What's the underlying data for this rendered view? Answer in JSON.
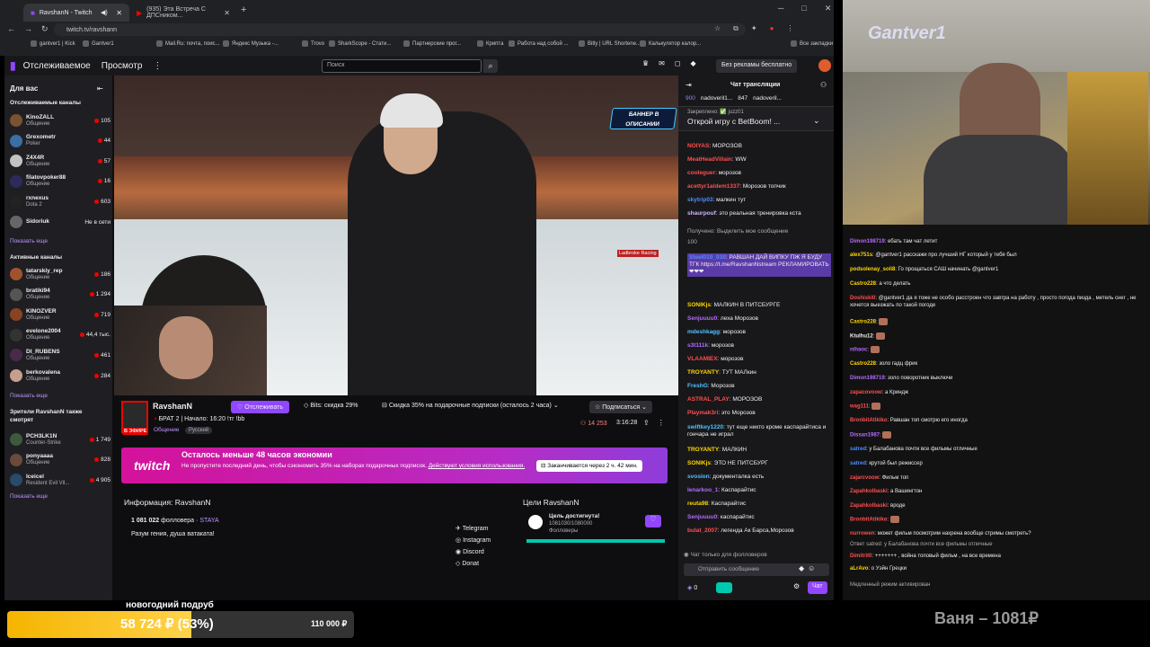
{
  "browser": {
    "tabs": [
      {
        "label": "RavshanN - Twitch"
      },
      {
        "label": "(935) Эта Встреча С ДПСником..."
      }
    ],
    "url": "twitch.tv/ravshann",
    "bookmarks": [
      "gantver1 | Kick",
      "Gantver1",
      "Mail.Ru: почта, поис...",
      "Яндекс Музыка -...",
      "Trovo",
      "SharkScope - Стати...",
      "Партнерские прог...",
      "Крипта",
      "Работа над собой ...",
      "Bitly | URL Shortene...",
      "Калькулятор калор...",
      "Все закладки"
    ]
  },
  "topnav": {
    "following": "Отслеживаемое",
    "browse": "Просмотр",
    "search_placeholder": "Поиск",
    "adfree": "Без рекламы бесплатно",
    "notif_count": "48"
  },
  "sidebar": {
    "for_you": "Для вас",
    "followed_title": "Отслеживаемые каналы",
    "followed": [
      {
        "name": "KinoZALL",
        "game": "Общение",
        "viewers": "105",
        "color": "#7a5230"
      },
      {
        "name": "Grexometr",
        "game": "Poker",
        "viewers": "44",
        "color": "#3a6ea5"
      },
      {
        "name": "Z4X4R",
        "game": "Общение",
        "viewers": "57",
        "color": "#c2c2c2"
      },
      {
        "name": "filatovpoker88",
        "game": "Общение",
        "viewers": "16",
        "color": "#2b2b5c"
      },
      {
        "name": "rxnexus",
        "game": "Dota 2",
        "viewers": "603",
        "color": "#222"
      },
      {
        "name": "Sidoriuk",
        "game": "",
        "viewers": "Не в сети",
        "color": "#666"
      }
    ],
    "show_more": "Показать еще",
    "active_title": "Активные каналы",
    "active": [
      {
        "name": "tatarskiy_rep",
        "game": "Общение",
        "viewers": "186",
        "color": "#a0522d"
      },
      {
        "name": "bratiki94",
        "game": "Общение",
        "viewers": "1 294",
        "color": "#555"
      },
      {
        "name": "KINOZVER",
        "game": "Общение",
        "viewers": "719",
        "color": "#884422"
      },
      {
        "name": "evelone2004",
        "game": "Общение",
        "viewers": "44,4 тыс.",
        "color": "#333"
      },
      {
        "name": "DI_RUBENS",
        "game": "Общение",
        "viewers": "461",
        "color": "#4a2a4a"
      },
      {
        "name": "berkovalena",
        "game": "Общение",
        "viewers": "284",
        "color": "#c89f8f"
      }
    ],
    "also_title": "Зрители RavshanN также смотрят",
    "also": [
      {
        "name": "PCH3LK1N",
        "game": "Counter-Strike",
        "viewers": "1 749",
        "color": "#3c5a3c"
      },
      {
        "name": "ponyaaaa",
        "game": "Общение",
        "viewers": "828",
        "color": "#6a4a3a"
      },
      {
        "name": "Iceicel",
        "game": "Resident Evil Vil...",
        "viewers": "4 905",
        "color": "#2a4a6a"
      }
    ]
  },
  "player": {
    "banner": "БАННЕР В ОПИСАНИИ",
    "banner_sub": "Ladbroke Racing"
  },
  "streamer": {
    "name": "RavshanN",
    "follow": "Отслеживать",
    "bits": "Bits: скидка 29%",
    "subs_discount": "Скидка 35% на подарочные подписки (осталось 2 часа)",
    "subscribe": "Подписаться",
    "title": "БРАТ 2 | Начало: 16:20 !тг !bb",
    "category": "Общение",
    "lang": "Русский",
    "live": "В ЭФИРЕ",
    "viewers": "14 253",
    "uptime": "3:16:28"
  },
  "promo": {
    "logo": "twitch",
    "title": "Осталось меньше 48 часов экономии",
    "text": "Не пропустите последний день, чтобы сэкономить 35% на наборах подарочных подписок.",
    "terms": "Действуют условия использования.",
    "timer": "Заканчивается через 2 ч. 42 мин."
  },
  "about": {
    "title": "Информация: RavshanN",
    "followers": "1 081 022",
    "followers_label": "фолловера",
    "team": "STAYA",
    "bio": "Разум гения, душа ватаката!",
    "links": [
      "Telegram",
      "Instagram",
      "Discord",
      "Donat"
    ],
    "goals_title": "Цели RavshanN",
    "goal_label": "Цель достигнута!",
    "goal_value": "1081030/1080000",
    "goal_unit": "Фолловеры",
    "goal_progress": 1.0
  },
  "chat": {
    "title": "Чат трансляции",
    "leaders": [
      {
        "name": "900",
        "color": "#8a8aff"
      },
      {
        "name": "nadoveril1...",
        "color": "#efeff1"
      },
      {
        "name": "847",
        "color": "#efeff1"
      },
      {
        "name": "nadoveril...",
        "color": "#efeff1"
      }
    ],
    "pinned_label": "Закреплено: ✅ juzz01",
    "pinned": "Открой игру с BetBoom! ...",
    "messages": [
      {
        "user": "NOIYAS",
        "text": "МОРОЗОВ",
        "color": "#ff4f4f"
      },
      {
        "user": "MeatHeadVillain",
        "text": "WW",
        "color": "#ff4f4f"
      },
      {
        "user": "cooleguer",
        "text": "морозов",
        "color": "#ff4f4f"
      },
      {
        "user": "acettyr1aldem1337",
        "text": "Морозов топчик",
        "color": "#ff4f4f"
      },
      {
        "user": "skytrip03",
        "text": "малкин тут",
        "color": "#4f8cff"
      },
      {
        "user": "shaurpouf",
        "text": "это реальная тренировка кста",
        "color": "#d1b4ff"
      },
      {
        "user": "",
        "text": "Получено: Выделить мое сообщение",
        "color": "#adadb8"
      },
      {
        "user": "",
        "text": "100",
        "color": "#adadb8"
      },
      {
        "user": "Steel010_030",
        "text": "РАВШАН ДАЙ ВИПКУ ПЖ Я БУДУ ТГК https://t.me/RavshanNstream РЕКЛАМИРОВАТЬ ❤❤❤",
        "color": "#4f8cff"
      },
      {
        "user": "SONIKjs",
        "text": "МАЛКИН В ПИТСБУРГЕ",
        "color": "#ffd700"
      },
      {
        "user": "Senjuuuu0",
        "text": "леха Морозов",
        "color": "#b36bff"
      },
      {
        "user": "mdeshkagg",
        "text": "морозов",
        "color": "#4fc3ff"
      },
      {
        "user": "s3t111k",
        "text": "морозов",
        "color": "#b36bff"
      },
      {
        "user": "VLAAMIEX",
        "text": "морозов",
        "color": "#ff4f4f"
      },
      {
        "user": "TROYANTY",
        "text": "ТУТ МАЛкин",
        "color": "#ffd700"
      },
      {
        "user": "FreshG",
        "text": "Морозов",
        "color": "#4fc3ff"
      },
      {
        "user": "ASTRAL_PLAY",
        "text": "МОРОЗОВ",
        "color": "#ff4f4f"
      },
      {
        "user": "Playmak3ri",
        "text": "это Морозов",
        "color": "#ff4f4f"
      },
      {
        "user": "swiftkey1220",
        "text": "тут еще никто кроме каспарайтиса и гончара не играл",
        "color": "#4fc3ff"
      },
      {
        "user": "TROYANTY",
        "text": "МАЛКИН",
        "color": "#ffd700"
      },
      {
        "user": "SONIKjs",
        "text": "ЭТО НЕ ПИТСБУРГ",
        "color": "#ffd700"
      },
      {
        "user": "svosion",
        "text": "документалка есть",
        "color": "#4fc3ff"
      },
      {
        "user": "lenarkoo_1",
        "text": "Каспарайтис",
        "color": "#b36bff"
      },
      {
        "user": "reuta98",
        "text": "Каспарайтис",
        "color": "#ffd700"
      },
      {
        "user": "Senjuuuu0",
        "text": "каспарайтис",
        "color": "#b36bff"
      },
      {
        "user": "bulat_2007",
        "text": "легенда Ак Барса,Морозов",
        "color": "#ff4f4f"
      }
    ],
    "followers_only": "Чат только для фолловеров",
    "input_placeholder": "Отправить сообщение",
    "points": "0",
    "send": "Чат"
  },
  "cam": {
    "name": "Gantver1"
  },
  "right_chat": [
    {
      "user": "Dimon198719",
      "text": "ебать там чат летит",
      "color": "#b36bff"
    },
    {
      "user": "alex751s",
      "text": "@gantver1 расскажи про лучший НГ который у тебя был",
      "color": "#ffd700"
    },
    {
      "user": "podsolenay_soli8",
      "text": "Го прощаться САШ начинать @gantver1",
      "color": "#ffd700"
    },
    {
      "user": "Castro228",
      "text": "а что делать",
      "color": "#ffd700"
    },
    {
      "user": "Doshiski0",
      "text": "@gantver1 да я тоже не особо расстроен что завтра на работу , просто погода пизда , метель снег , не хочется выезжать по такой погоде",
      "color": "#ff4f4f"
    },
    {
      "user": "Castro228",
      "text": "",
      "color": "#ffd700"
    },
    {
      "user": "Ktulhu12",
      "text": "",
      "color": "#efeff1"
    },
    {
      "user": "nihaoc",
      "text": "",
      "color": "#b36bff"
    },
    {
      "user": "Castro228",
      "text": "золо гадц фрик",
      "color": "#ffd700"
    },
    {
      "user": "Dimon198719",
      "text": "золо поворотник выключи",
      "color": "#b36bff"
    },
    {
      "user": "zapacovoow",
      "text": "а Криндж",
      "color": "#ff4f4f"
    },
    {
      "user": "wag111",
      "text": "",
      "color": "#ff4f4f"
    },
    {
      "user": "BronbitAtikiko",
      "text": "Равшан топ смотрю его иногда",
      "color": "#ff4f4f"
    },
    {
      "user": "Dissan1987",
      "text": "",
      "color": "#b36bff"
    },
    {
      "user": "satred",
      "text": "у Балабанова почти все фильмы отличные",
      "color": "#4f8cff"
    },
    {
      "user": "satred",
      "text": "крутой был режиссер",
      "color": "#4f8cff"
    },
    {
      "user": "zajarcvoow",
      "text": "Фильм топ",
      "color": "#ff4f4f"
    },
    {
      "user": "Zapahkolbaski",
      "text": "а Вашингтон",
      "color": "#ff4f4f"
    },
    {
      "user": "Zapahkolbaski",
      "text": "вроде",
      "color": "#ff4f4f"
    },
    {
      "user": "BronbitAtikiko",
      "text": "",
      "color": "#ff4f4f"
    },
    {
      "user": "nurrowen",
      "text": "может фильм посмотрим нахрена вообще стримы смотреть?",
      "color": "#ff4f4f"
    },
    {
      "user": "",
      "text": "Ответ satred: у Балабанова почти все фильмы отличные",
      "color": "#adadb8"
    },
    {
      "user": "Dimitrit0",
      "text": "+++++++ , война топовый фильм , на все времена",
      "color": "#ff4f4f"
    },
    {
      "user": "aLrAvo",
      "text": "о Уэйн Грецки",
      "color": "#ffd700"
    },
    {
      "user": "",
      "text": "Медленный режим активирован",
      "color": "#adadb8"
    }
  ],
  "overlay": {
    "goal_title": "новогодний подруб",
    "goal_amount": "58 724 ₽ (53%)",
    "goal_target": "110 000 ₽",
    "goal_progress": 0.53,
    "donor": "Ваня – 1081₽"
  }
}
